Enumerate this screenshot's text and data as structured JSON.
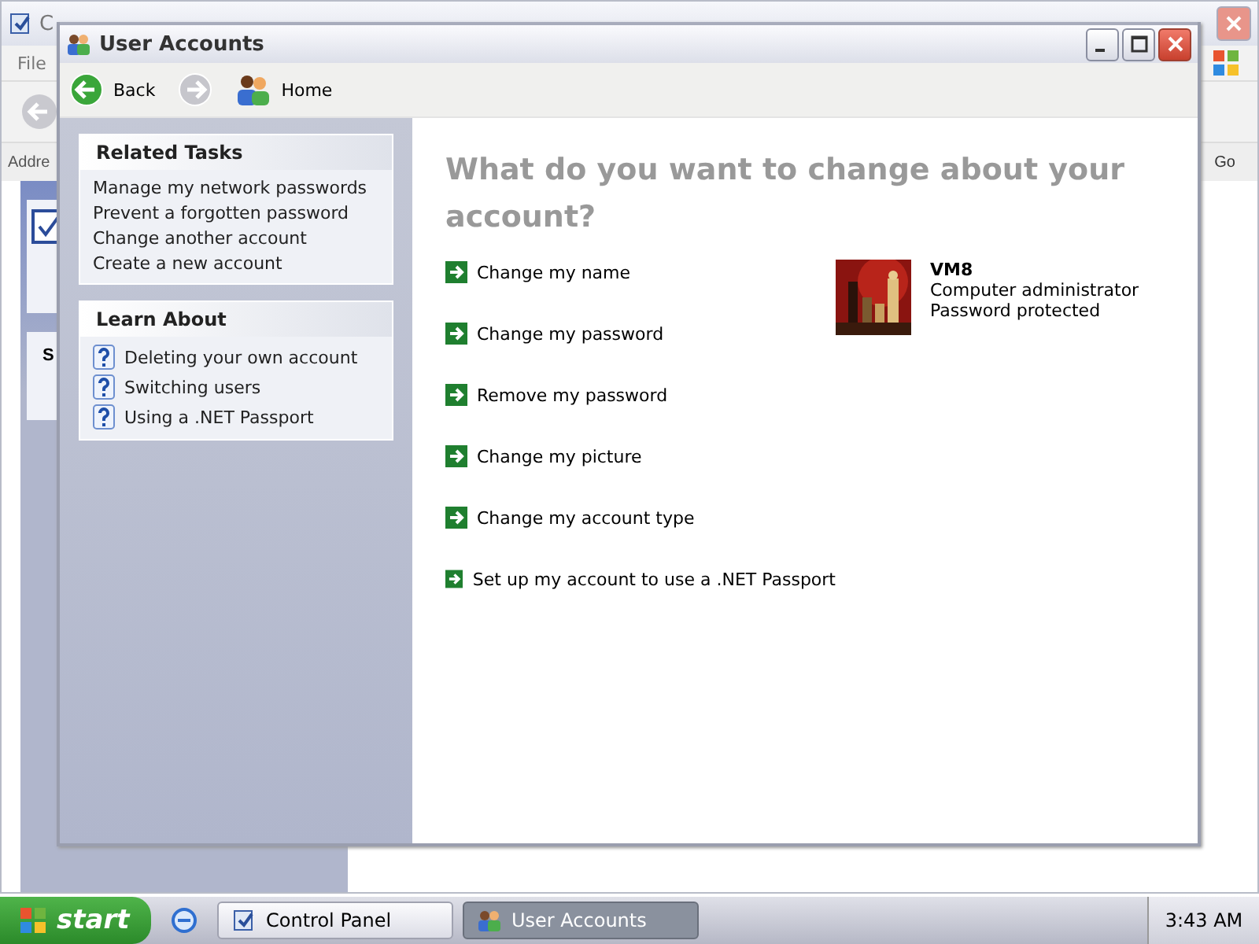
{
  "background_window": {
    "title": "C",
    "menu": [
      "File"
    ],
    "address_label": "Addre",
    "go_button": "Go",
    "panel_heading": "S"
  },
  "window": {
    "title": "User Accounts"
  },
  "toolbar": [
    {
      "kind": "back",
      "label": "Back",
      "disabled": false
    },
    {
      "kind": "forward",
      "disabled": true
    },
    {
      "kind": "home",
      "label": "Home",
      "disabled": false
    }
  ],
  "sidebar": [
    {
      "title": "Related Tasks",
      "kind": "tasks",
      "items": [
        "Manage my network passwords",
        "Prevent a forgotten password",
        "Change another account",
        "Create a new account"
      ]
    },
    {
      "title": "Learn About",
      "kind": "help",
      "items": [
        "Deleting your own account",
        "Switching users",
        "Using a .NET Passport"
      ]
    }
  ],
  "heading": "What do you want to change about your account?",
  "tasks": [
    "Change my name",
    "Change my password",
    "Remove my password",
    "Change my picture",
    "Change my account type",
    "Set up my account to use a .NET Passport"
  ],
  "account": {
    "name": "VM8",
    "type": "Computer administrator",
    "status": "Password protected"
  },
  "taskbar": {
    "start": "start",
    "items": [
      {
        "label": "Control Panel",
        "selected": false,
        "kind": "folder"
      },
      {
        "label": "User Accounts",
        "selected": true,
        "kind": "users"
      }
    ],
    "clock": "3:43 AM"
  }
}
